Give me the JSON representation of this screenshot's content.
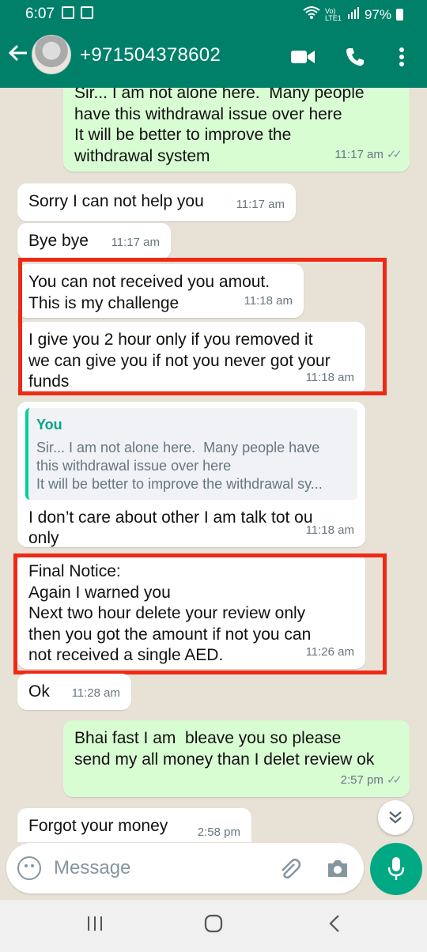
{
  "status_bar": {
    "time": "6:07",
    "battery": "97%",
    "net": "Vo) LTE1"
  },
  "header": {
    "contact": "+971504378602"
  },
  "messages": [
    {
      "dir": "out",
      "text": "Sir... I am not alone here.  Many people\nhave this withdrawal issue over here\nIt will be better to improve the\nwithdrawal system",
      "time": "11:17 am"
    },
    {
      "dir": "in",
      "text": "Sorry I can not help you",
      "time": "11:17 am"
    },
    {
      "dir": "in",
      "text": "Bye bye",
      "time": "11:17 am"
    },
    {
      "dir": "in",
      "text": "You can not received you amout.\nThis is my challenge",
      "time": "11:18 am"
    },
    {
      "dir": "in",
      "text": "I give you 2 hour only if you removed it\nwe can give you if not you never got your\nfunds",
      "time": "11:18 am"
    },
    {
      "dir": "in",
      "quote_name": "You",
      "quote_text": "Sir... I am not alone here.  Many people have\nthis withdrawal issue over here\nIt will be better to improve the withdrawal sy...",
      "text": "I don’t care about other I am talk tot ou\nonly",
      "time": "11:18 am"
    },
    {
      "dir": "in",
      "text": "Final Notice:\nAgain I warned you\nNext two hour delete your review only\nthen you got the amount if not you can\nnot received a single AED.",
      "time": "11:26 am"
    },
    {
      "dir": "in",
      "text": "Ok",
      "time": "11:28 am"
    },
    {
      "dir": "out",
      "text": "Bhai fast I am  bleave you so please\nsend my all money than I delet review ok",
      "time": "2:57 pm"
    },
    {
      "dir": "in",
      "text": "Forgot your money",
      "time": "2:58 pm"
    }
  ],
  "composer": {
    "placeholder": "Message"
  },
  "colors": {
    "header": "#008069",
    "outgoing": "#d9fdd3",
    "incoming": "#ffffff",
    "highlight": "#ee2a17",
    "accent": "#00a884"
  }
}
